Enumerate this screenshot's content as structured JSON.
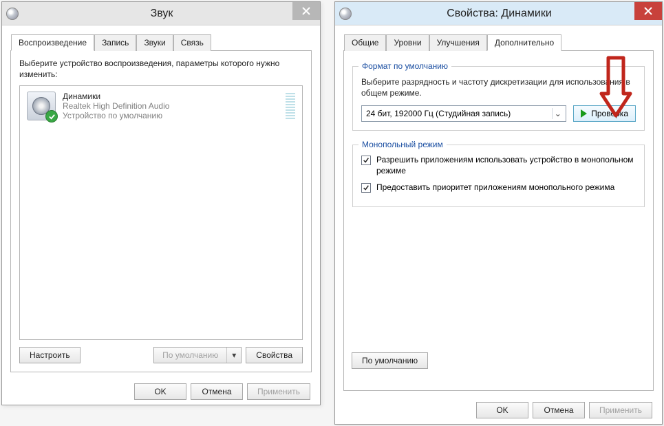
{
  "sound": {
    "title": "Звук",
    "tabs": [
      "Воспроизведение",
      "Запись",
      "Звуки",
      "Связь"
    ],
    "active_tab": 0,
    "instruction": "Выберите устройство воспроизведения, параметры которого нужно изменить:",
    "device": {
      "name": "Динамики",
      "driver": "Realtek High Definition Audio",
      "status": "Устройство по умолчанию"
    },
    "btn_configure": "Настроить",
    "btn_default": "По умолчанию",
    "btn_properties": "Свойства",
    "btn_ok": "OK",
    "btn_cancel": "Отмена",
    "btn_apply": "Применить"
  },
  "props": {
    "title": "Свойства: Динамики",
    "tabs": [
      "Общие",
      "Уровни",
      "Улучшения",
      "Дополнительно"
    ],
    "active_tab": 3,
    "group_fmt_title": "Формат по умолчанию",
    "group_fmt_msg": "Выберите разрядность и частоту дискретизации для использования в общем режиме.",
    "format_selected": "24 бит, 192000 Гц (Студийная запись)",
    "btn_test": "Проверка",
    "group_excl_title": "Монопольный режим",
    "chk1": "Разрешить приложениям использовать устройство в монопольном режиме",
    "chk2": "Предоставить приоритет приложениям монопольного режима",
    "btn_defaults": "По умолчанию",
    "btn_ok": "OK",
    "btn_cancel": "Отмена",
    "btn_apply": "Применить"
  }
}
